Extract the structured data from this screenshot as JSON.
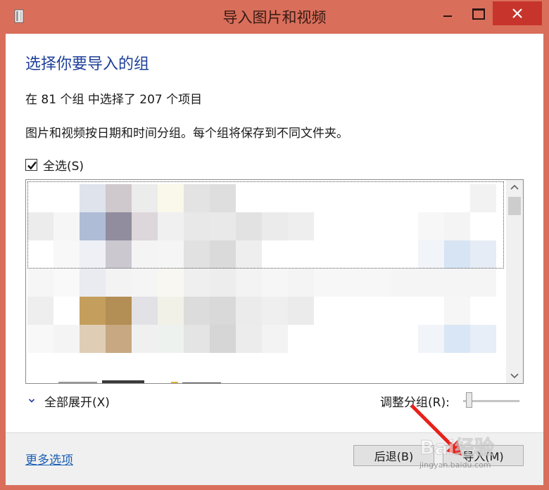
{
  "window": {
    "title": "导入图片和视频",
    "colors": {
      "frame": "#d96f5b",
      "close": "#c7342b",
      "heading": "#1e3f9a",
      "link": "#1a5fb4"
    }
  },
  "main": {
    "heading": "选择你要导入的组",
    "count_text": "在 81 个组 中选择了 207 个项目",
    "description": "图片和视频按日期和时间分组。每个组将保存到不同文件夹。",
    "select_all_label": "全选(S)",
    "select_all_checked": true,
    "expand_all_label": "全部展开(X)",
    "adjust_group_label": "调整分组(R):",
    "slider_value": 0.05
  },
  "footer": {
    "more_options": "更多选项",
    "back_button": "后退(B)",
    "import_button": "导入(M)"
  },
  "watermark": {
    "text": "Bai经验",
    "sub": "jingyan.baidu.com"
  }
}
